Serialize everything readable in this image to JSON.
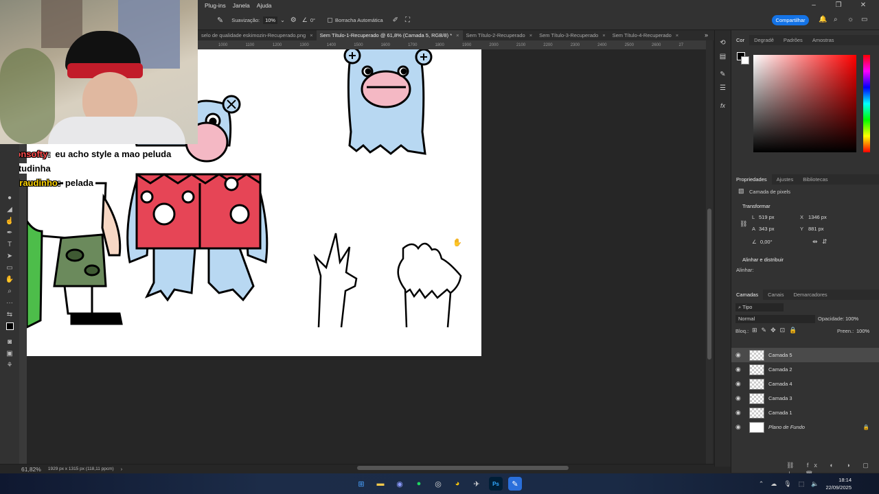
{
  "menu": {
    "items": [
      "Plug-ins",
      "Janela",
      "Ajuda"
    ]
  },
  "options": {
    "smoothing_label": "Suavização:",
    "smoothing_value": "10%",
    "angle_value": "0°",
    "auto_erase_label": "Borracha Automática",
    "share_label": "Compartilhar"
  },
  "tabs": [
    {
      "label": "selo de qualidade eskimozin-Recuperado.png",
      "active": false
    },
    {
      "label": "Sem Título-1-Recuperado @ 61,8% (Camada 5, RGB/8) *",
      "active": true
    },
    {
      "label": "Sem Título-2-Recuperado",
      "active": false
    },
    {
      "label": "Sem Título-3-Recuperado",
      "active": false
    },
    {
      "label": "Sem Título-4-Recuperado",
      "active": false
    }
  ],
  "ruler": [
    "1000",
    "1100",
    "1200",
    "1300",
    "1400",
    "1500",
    "1600",
    "1700",
    "1800",
    "1900",
    "2000",
    "2100",
    "2200",
    "2300",
    "2400",
    "2500",
    "2600",
    "27"
  ],
  "status": {
    "zoom": "61,82%",
    "doc_info": "1929 px x 1315 px (118,11 ppcm)"
  },
  "chat": [
    {
      "user": "devonsofty",
      "message": "eu acho style a mao peluda"
    },
    {
      "user": "",
      "message": "pontudinha"
    },
    {
      "user": "odraudinho",
      "message": "pelada"
    }
  ],
  "color_panel": {
    "tabs": [
      "Cor",
      "Degradê",
      "Padrões",
      "Amostras"
    ],
    "hue_color": "#ff0000"
  },
  "properties": {
    "tabs": [
      "Propriedades",
      "Ajustes",
      "Bibliotecas"
    ],
    "layer_type": "Camada de pixels",
    "transform_title": "Transformar",
    "L": "519 px",
    "A": "343 px",
    "X": "1346 px",
    "Y": "881 px",
    "angle": "0,00°",
    "align_title": "Alinhar e distribuir",
    "align_label": "Alinhar:"
  },
  "layers_panel": {
    "tabs": [
      "Camadas",
      "Canais",
      "Demarcadores"
    ],
    "filter": "Tipo",
    "blend": "Normal",
    "opacity_label": "Opacidade:",
    "opacity": "100%",
    "lock_label": "Bloq.:",
    "fill_label": "Preen.:",
    "fill": "100%",
    "layers": [
      {
        "name": "Camada 5",
        "selected": true
      },
      {
        "name": "Camada 2",
        "selected": false
      },
      {
        "name": "Camada 4",
        "selected": false
      },
      {
        "name": "Camada 3",
        "selected": false
      },
      {
        "name": "Camada 1",
        "selected": false
      },
      {
        "name": "Plano de Fundo",
        "selected": false
      }
    ]
  },
  "taskbar": {
    "time": "18:14",
    "date": "22/09/2025"
  }
}
